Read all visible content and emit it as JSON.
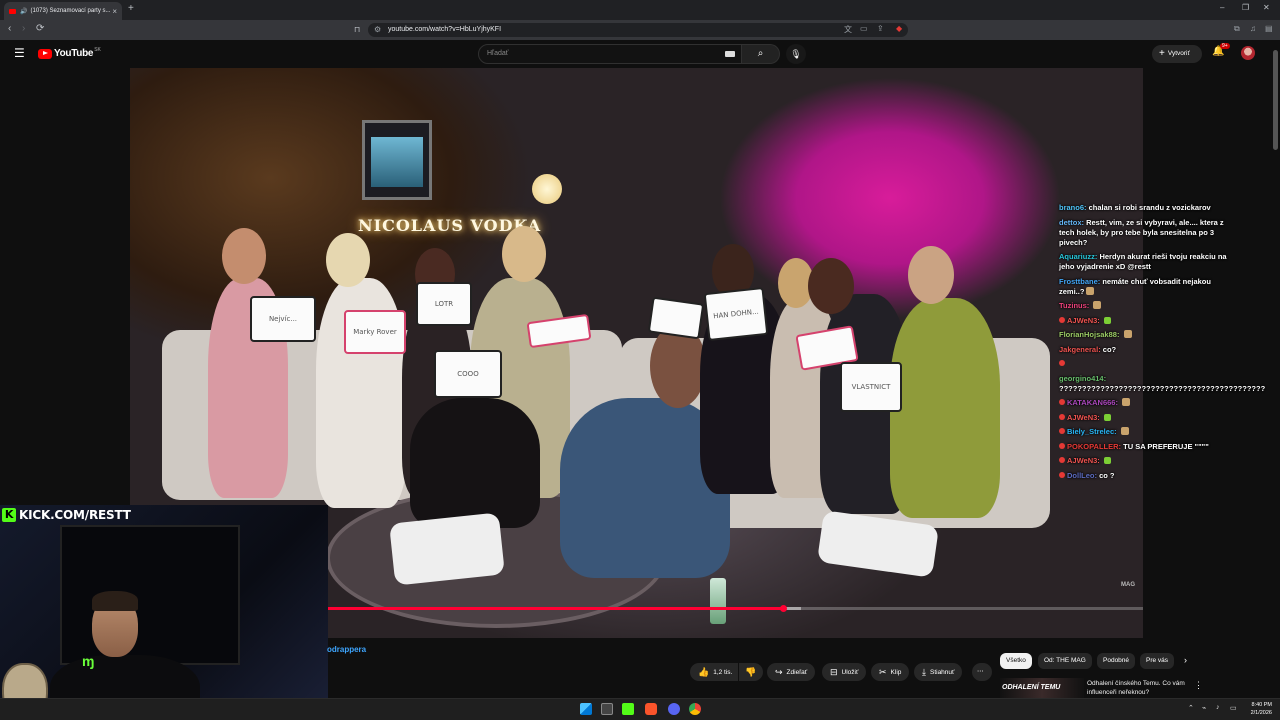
{
  "browser": {
    "tab_title": "(1073) Seznamovací party s...",
    "tab_close": "×",
    "new_tab": "+",
    "url": "youtube.com/watch?v=HbLuYjhyKFI",
    "window_controls": [
      "–",
      "❐",
      "✕"
    ]
  },
  "youtube": {
    "logo_text": "YouTube",
    "country_code": "SK",
    "search_placeholder": "Hľadať",
    "create_label": "Vytvoriť",
    "notification_count": "9+"
  },
  "video": {
    "sign_text": "NICOLAUS VODKA",
    "boards": [
      "Nejvíc...",
      "Marky Rover",
      "LOTR",
      "COOO",
      "",
      "",
      "HAN DOHN...",
      "",
      "VLASTNICT"
    ],
    "watermark": "MAG",
    "progress_played_fraction": 0.645,
    "progress_loaded_fraction": 0.662
  },
  "chat": {
    "messages": [
      {
        "user": "brano6:",
        "text": "chalan si robi srandu z vozickarov",
        "color": "#4fc3f7",
        "badge": false,
        "emote": ""
      },
      {
        "user": "dettox:",
        "text": "Restt, vim, ze si vybyravi, ale.... ktera z tech holek, by pro tebe byla snesitelna po 3 pivech?",
        "color": "#64b5f6",
        "badge": false,
        "emote": ""
      },
      {
        "user": "Aquariuzz:",
        "text": "Herdyn akurat rieši tvoju reakciu na jeho vyjadrenie xD @restt",
        "color": "#26c6da",
        "badge": false,
        "emote": ""
      },
      {
        "user": "Frosttbane:",
        "text": "nemáte chuť vobsadit nejakou zemi..?",
        "color": "#42a5f5",
        "badge": false,
        "emote": "tan"
      },
      {
        "user": "Tuzinus:",
        "text": "",
        "color": "#ec407a",
        "badge": false,
        "emote": "tan"
      },
      {
        "user": "AJWeN3:",
        "text": "",
        "color": "#ef5350",
        "badge": true,
        "emote": "green"
      },
      {
        "user": "FlorianHojsak88:",
        "text": "",
        "color": "#9ccc65",
        "badge": false,
        "emote": "tan"
      },
      {
        "user": "Jakgeneral:",
        "text": "co?",
        "color": "#ef5350",
        "badge": false,
        "emote": ""
      },
      {
        "user": "",
        "text": "",
        "color": "#ef5350",
        "badge": true,
        "emote": ""
      },
      {
        "user": "georgino414:",
        "text": "?????????????????????????????????????????????",
        "color": "#66bb6a",
        "badge": false,
        "emote": ""
      },
      {
        "user": "KATAKAN666:",
        "text": "",
        "color": "#ab47bc",
        "badge": true,
        "emote": "tan"
      },
      {
        "user": "AJWeN3:",
        "text": "",
        "color": "#ef5350",
        "badge": true,
        "emote": "green"
      },
      {
        "user": "Biely_Strelec:",
        "text": "",
        "color": "#29b6f6",
        "badge": true,
        "emote": "tan"
      },
      {
        "user": "POKOPALLER:",
        "text": "TU SA PREFERUJE \"\"\"\"",
        "color": "#e53935",
        "badge": true,
        "emote": ""
      },
      {
        "user": "AJWeN3:",
        "text": "",
        "color": "#ef5350",
        "badge": true,
        "emote": "green"
      },
      {
        "user": "DollLeo:",
        "text": "co ?",
        "color": "#5c6bc0",
        "badge": true,
        "emote": ""
      }
    ]
  },
  "stream_overlay": {
    "kick_icon": "K",
    "kick_url": "KICK.COM/RESTT"
  },
  "below_video": {
    "channel_name": "odrappera",
    "like_count": "1,2 tis.",
    "share_label": "Zdieľať",
    "save_label": "Uložiť",
    "clip_label": "Klip",
    "download_label": "Stiahnuť",
    "more_label": "⋯"
  },
  "chips": [
    "Všetko",
    "Od: THE MAG",
    "Podobné",
    "Pre vás"
  ],
  "recommendation": {
    "thumb_text": "ODHALENÍ TEMU",
    "title": "Odhalení čínského Temu. Co vám influenceři neřeknou?"
  },
  "taskbar": {
    "time": "8:40 PM",
    "date": "2/1/2026"
  }
}
